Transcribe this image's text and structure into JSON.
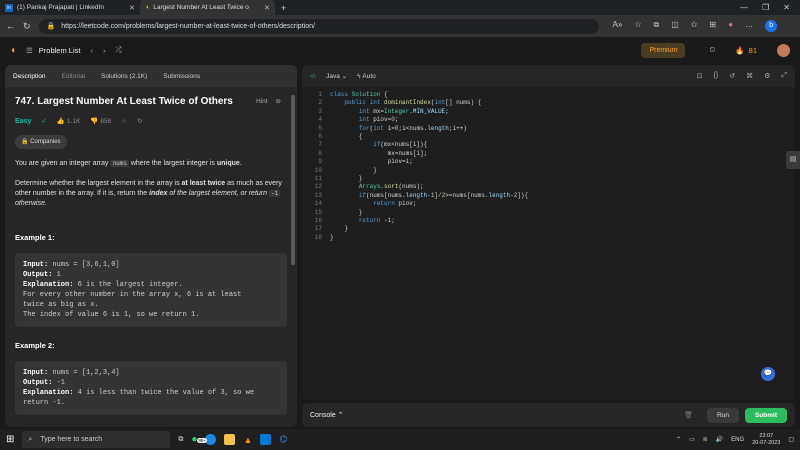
{
  "browser": {
    "tabs": [
      {
        "label": "(1) Pankaj Prajapati | LinkedIn",
        "icon": "linkedin-icon"
      },
      {
        "label": "Largest Number At Least Twice o",
        "icon": "leetcode-icon"
      }
    ],
    "url": "https://leetcode.com/problems/largest-number-at-least-twice-of-others/description/"
  },
  "nav": {
    "problem_list": "Problem List",
    "premium": "Premium",
    "streak": "81"
  },
  "left_tabs": [
    "Description",
    "Editorial",
    "Solutions (2.1K)",
    "Submissions"
  ],
  "problem": {
    "title": "747. Largest Number At Least Twice of Others",
    "hint": "Hint",
    "difficulty": "Easy",
    "likes": "1.1K",
    "dislikes": "858",
    "companies": "Companies",
    "p1_a": "You are given an integer array ",
    "p1_code": "nums",
    "p1_b": " where the largest integer is ",
    "p1_bold": "unique",
    "p1_end": ".",
    "p2_a": "Determine whether the largest element in the array is ",
    "p2_bold": "at least twice",
    "p2_b": " as much as every other number in the array. If it is, return the ",
    "p2_bi": "index",
    "p2_c": " of the largest element, or return ",
    "p2_code": "-1",
    "p2_d": " otherwise.",
    "ex1_title": "Example 1:",
    "ex1_input_label": "Input:",
    "ex1_input": " nums = [3,6,1,0]",
    "ex1_output_label": "Output:",
    "ex1_output": " 1",
    "ex1_expl_label": "Explanation:",
    "ex1_expl": " 6 is the largest integer.",
    "ex1_expl2": "For every other number in the array x, 6 is at least",
    "ex1_expl3": "twice as big as x.",
    "ex1_expl4": "The index of value 6 is 1, so we return 1.",
    "ex2_title": "Example 2:",
    "ex2_input_label": "Input:",
    "ex2_input": " nums = [1,2,3,4]",
    "ex2_output_label": "Output:",
    "ex2_output": " -1",
    "ex2_expl_label": "Explanation:",
    "ex2_expl": " 4 is less than twice the value of 3, so we",
    "ex2_expl2": "return -1."
  },
  "editor": {
    "language": "Java",
    "mode": "Auto",
    "lines": [
      "class Solution {",
      "    public int dominantIndex(int[] nums) {",
      "        int mx=Integer.MIN_VALUE;",
      "        int piov=0;",
      "        for(int i=0;i<nums.length;i++)",
      "        {",
      "            if(mx<nums[i]){",
      "                mx=nums[i];",
      "                piov=i;",
      "            }",
      "        }",
      "        Arrays.sort(nums);",
      "        if(nums[nums.length-1]/2>=nums[nums.length-2]){",
      "            return piov;",
      "        }",
      "        return -1;",
      "    }",
      "}"
    ]
  },
  "console": {
    "label": "Console",
    "run": "Run",
    "submit": "Submit"
  },
  "taskbar": {
    "search_placeholder": "Type here to search",
    "badge": "99+",
    "lang": "ENG",
    "time": "23:07",
    "date": "20-07-2023"
  },
  "colors": {
    "accent": "#ffa116",
    "easy": "#00b8a3",
    "submit": "#2cbb5d"
  }
}
